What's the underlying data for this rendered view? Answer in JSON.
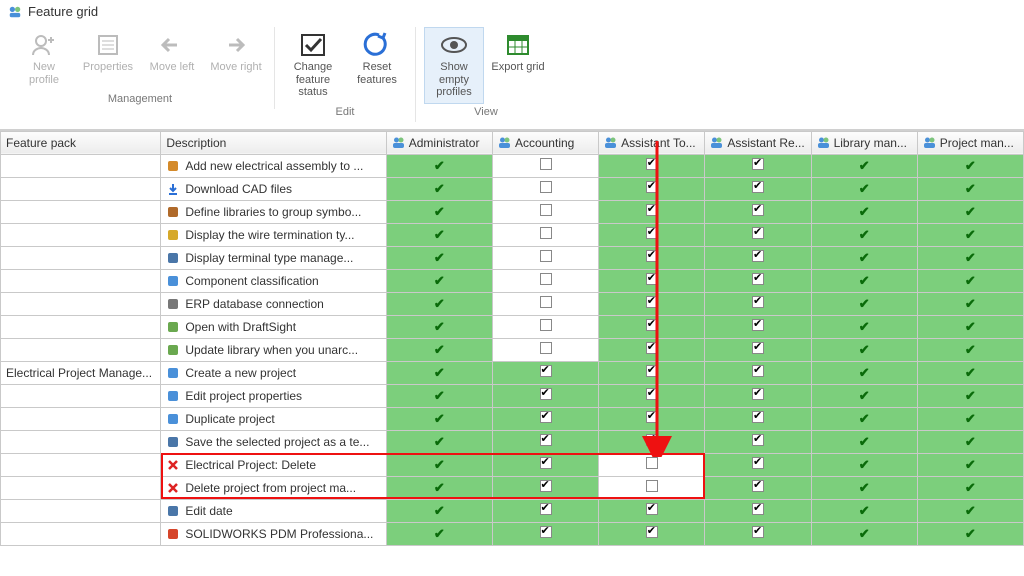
{
  "window": {
    "title": "Feature grid"
  },
  "ribbon": {
    "groups": [
      {
        "label": "Management",
        "buttons": [
          {
            "id": "new-profile",
            "label": "New profile",
            "disabled": true,
            "icon": "user-plus"
          },
          {
            "id": "properties",
            "label": "Properties",
            "disabled": true,
            "icon": "list"
          },
          {
            "id": "move-left",
            "label": "Move left",
            "disabled": true,
            "icon": "arrow-left"
          },
          {
            "id": "move-right",
            "label": "Move right",
            "disabled": true,
            "icon": "arrow-right"
          }
        ]
      },
      {
        "label": "Edit",
        "buttons": [
          {
            "id": "change-feature-status",
            "label": "Change feature status",
            "disabled": false,
            "icon": "check-box"
          },
          {
            "id": "reset-features",
            "label": "Reset features",
            "disabled": false,
            "icon": "undo"
          }
        ]
      },
      {
        "label": "View",
        "buttons": [
          {
            "id": "show-empty-profiles",
            "label": "Show empty profiles",
            "disabled": false,
            "icon": "eye",
            "active": true
          },
          {
            "id": "export-grid",
            "label": "Export grid",
            "disabled": false,
            "icon": "spreadsheet"
          }
        ]
      }
    ]
  },
  "grid": {
    "columns": [
      "Feature pack",
      "Description",
      "Administrator",
      "Accounting",
      "Assistant To...",
      "Assistant Re...",
      "Library man...",
      "Project man..."
    ],
    "feature_packs": [
      {
        "name": "",
        "rows": [
          {
            "desc": "Add new electrical assembly to ...",
            "icon": "plug",
            "cells": [
              "tick",
              "box",
              "boxc",
              "boxc",
              "tick",
              "tick"
            ]
          },
          {
            "desc": "Download CAD files",
            "icon": "download",
            "cells": [
              "tick",
              "box",
              "boxc",
              "boxc",
              "tick",
              "tick"
            ]
          },
          {
            "desc": "Define libraries to group symbo...",
            "icon": "books",
            "cells": [
              "tick",
              "box",
              "boxc",
              "boxc",
              "tick",
              "tick"
            ]
          },
          {
            "desc": "Display the wire termination ty...",
            "icon": "bulb",
            "cells": [
              "tick",
              "box",
              "boxc",
              "boxc",
              "tick",
              "tick"
            ]
          },
          {
            "desc": "Display terminal type manage...",
            "icon": "terminal",
            "cells": [
              "tick",
              "box",
              "boxc",
              "boxc",
              "tick",
              "tick"
            ]
          },
          {
            "desc": "Component classification",
            "icon": "components",
            "cells": [
              "tick",
              "box",
              "boxc",
              "boxc",
              "tick",
              "tick"
            ]
          },
          {
            "desc": "ERP database connection",
            "icon": "db",
            "cells": [
              "tick",
              "box",
              "boxc",
              "boxc",
              "tick",
              "tick"
            ]
          },
          {
            "desc": "Open with DraftSight",
            "icon": "draft",
            "cells": [
              "tick",
              "box",
              "boxc",
              "boxc",
              "tick",
              "tick-on"
            ]
          },
          {
            "desc": "Update library when you unarc...",
            "icon": "update",
            "cells": [
              "tick",
              "box",
              "boxc",
              "boxc",
              "tick",
              "tick"
            ]
          }
        ]
      },
      {
        "name": "Electrical Project Manage...",
        "rows": [
          {
            "desc": "Create a new project",
            "icon": "newproj",
            "cells": [
              "tick",
              "boxc-on",
              "boxc",
              "boxc",
              "tick",
              "tick-on"
            ]
          },
          {
            "desc": "Edit project properties",
            "icon": "editproj",
            "cells": [
              "tick",
              "boxc-on",
              "boxc",
              "boxc",
              "tick",
              "tick-on"
            ]
          },
          {
            "desc": "Duplicate project",
            "icon": "dup",
            "cells": [
              "tick",
              "boxc-on",
              "boxc",
              "boxc",
              "tick",
              "tick-on"
            ]
          },
          {
            "desc": "Save the selected project as a te...",
            "icon": "save",
            "cells": [
              "tick",
              "boxc-on",
              "boxc",
              "boxc",
              "tick",
              "tick-on"
            ]
          },
          {
            "desc": "Electrical Project: Delete",
            "icon": "xred",
            "cells": [
              "tick",
              "boxc-on",
              "box",
              "boxc",
              "tick",
              "tick-on"
            ]
          },
          {
            "desc": "Delete project from project ma...",
            "icon": "xred",
            "cells": [
              "tick",
              "boxc-on",
              "box",
              "boxc",
              "tick",
              "tick-on"
            ]
          },
          {
            "desc": "Edit date",
            "icon": "date",
            "cells": [
              "tick",
              "boxc-on",
              "boxc",
              "boxc",
              "tick",
              "tick-on"
            ]
          },
          {
            "desc": "SOLIDWORKS PDM Professiona...",
            "icon": "pdm",
            "cells": [
              "tick",
              "boxc-on",
              "boxc",
              "boxc",
              "tick",
              "tick-on"
            ]
          }
        ]
      }
    ]
  }
}
